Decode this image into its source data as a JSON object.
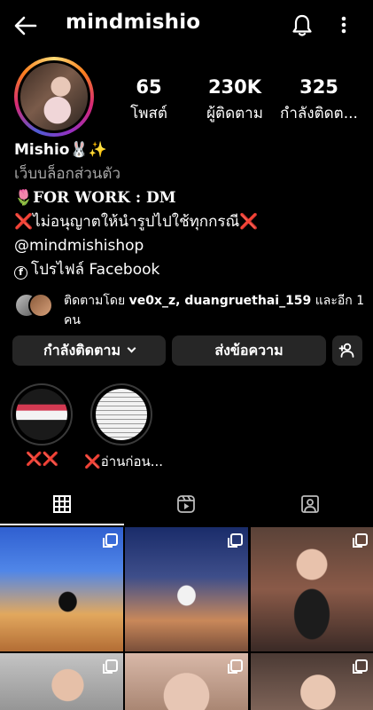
{
  "header": {
    "username": "mindmishio",
    "back_icon": "arrow-left-icon",
    "notification_icon": "bell-icon",
    "menu_icon": "more-vertical-icon"
  },
  "profile": {
    "stats": [
      {
        "value": "65",
        "label": "โพสต์"
      },
      {
        "value": "230K",
        "label": "ผู้ติดตาม"
      },
      {
        "value": "325",
        "label": "กำลังติดต..."
      }
    ],
    "display_name": "Mishio🐰✨",
    "category": "เว็บบล็อกส่วนตัว",
    "bio_work_emoji": "🌷",
    "bio_work": "FOR WORK  : DM",
    "bio_rule_mark": "❌",
    "bio_rule_text": "ไม่อนุญาตให้นำรูปไปใช้ทุกกรณี",
    "bio_handle": "@mindmishishop",
    "facebook_glyph": "f",
    "bio_facebook": "โปรไฟล์ Facebook"
  },
  "followed_by": {
    "prefix": "ติดตามโดย",
    "names": "ve0x_z, duangruethai_159",
    "suffix": "และอีก 1 คน"
  },
  "actions": {
    "following_label": "กำลังติดตาม",
    "message_label": "ส่งข้อความ",
    "add_user_icon": "add-user-icon"
  },
  "highlights": [
    {
      "mark": "❌❌",
      "text": ""
    },
    {
      "mark": "❌",
      "text": "อ่านก่อน..."
    }
  ],
  "tabs": [
    "grid-icon",
    "reels-icon",
    "tagged-icon"
  ],
  "colors": {
    "accent_red": "#e0242c",
    "button_bg": "#262626",
    "category_gray": "#a8a8a8"
  }
}
